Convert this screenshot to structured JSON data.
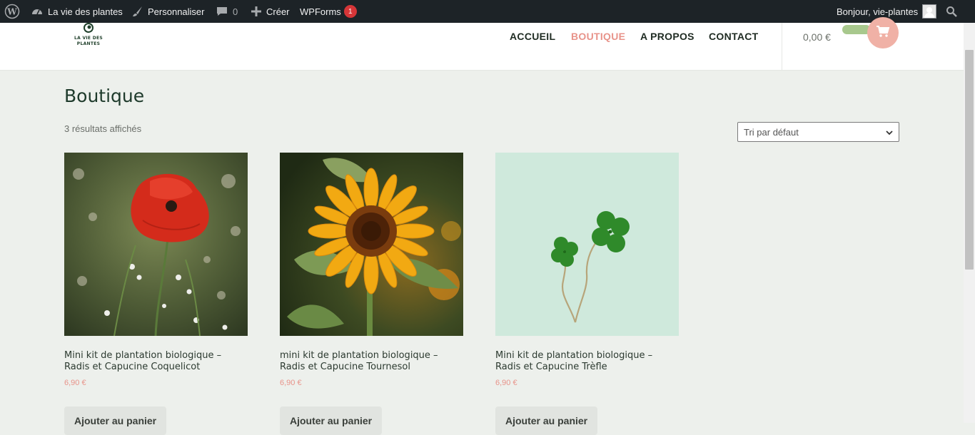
{
  "adminbar": {
    "site_name": "La vie des plantes",
    "customize": "Personnaliser",
    "comments_count": "0",
    "create": "Créer",
    "wpforms": "WPForms",
    "wpforms_badge": "1",
    "greeting": "Bonjour, vie-plantes"
  },
  "header": {
    "logo_line1": "LA VIE DES",
    "logo_line2": "PLANTES",
    "nav": [
      {
        "label": "ACCUEIL"
      },
      {
        "label": "BOUTIQUE",
        "active": true
      },
      {
        "label": "A PROPOS"
      },
      {
        "label": "CONTACT"
      }
    ],
    "cart_total": "0,00 €"
  },
  "main": {
    "title": "Boutique",
    "result_count": "3 résultats affichés",
    "sort": {
      "selected": "Tri par défaut"
    },
    "products": [
      {
        "name": "Mini kit de plantation biologique – Radis et Capucine Coquelicot",
        "price": "6,90 €",
        "button": "Ajouter au panier",
        "image": "poppy-flower"
      },
      {
        "name": "mini kit de plantation biologique – Radis et Capucine Tournesol",
        "price": "6,90 €",
        "button": "Ajouter au panier",
        "image": "sunflower"
      },
      {
        "name": "Mini kit de plantation biologique – Radis et Capucine Trèfle",
        "price": "6,90 €",
        "button": "Ajouter au panier",
        "image": "clover"
      }
    ]
  },
  "colors": {
    "adminbar_bg": "#1d2327",
    "accent": "#e8938a",
    "page_bg": "#edf0ec",
    "cart_button": "#f0b1a6"
  }
}
